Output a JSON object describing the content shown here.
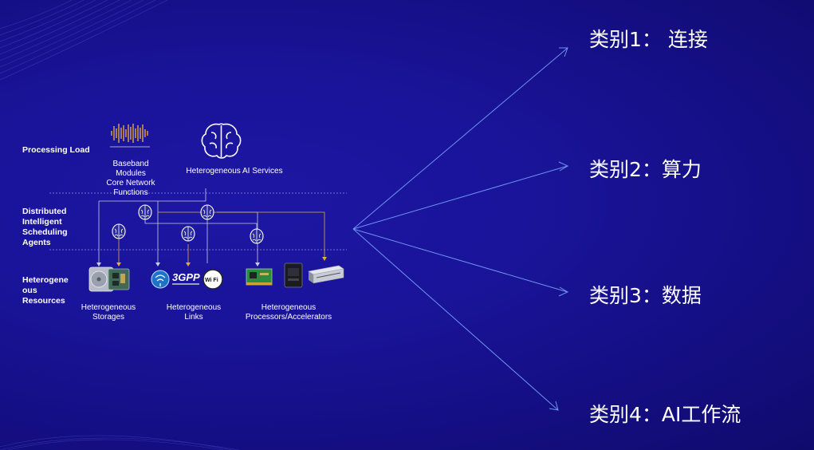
{
  "diagram": {
    "row_labels": {
      "processing_load": "Processing Load",
      "scheduling_agents": "Distributed\nIntelligent\nScheduling\nAgents",
      "resources": "Heterogene\nous\nResources"
    },
    "baseband_caption": "Baseband\nModules\nCore Network\nFunctions",
    "ai_services_caption": "Heterogeneous AI Services",
    "storages_caption": "Heterogeneous\nStorages",
    "links_caption": "Heterogeneous\nLinks",
    "processors_caption": "Heterogeneous\nProcessors/Accelerators",
    "links_badge_3gpp": "3GPP",
    "links_badge_wifi": "Wi Fi"
  },
  "categories": [
    "类别1： 连接",
    "类别2：算力",
    "类别3：数据",
    "类别4：AI工作流"
  ],
  "colors": {
    "background": "#1a149a",
    "arrow": "#6f93f0",
    "connector_white": "#c9cde0",
    "connector_yellow": "#e7a93a"
  },
  "icons": [
    "waveform-icon",
    "brain-icon",
    "hard-drive-icon",
    "network-card-icon",
    "3gpp-logo-icon",
    "wifi-logo-icon",
    "server-icon"
  ]
}
